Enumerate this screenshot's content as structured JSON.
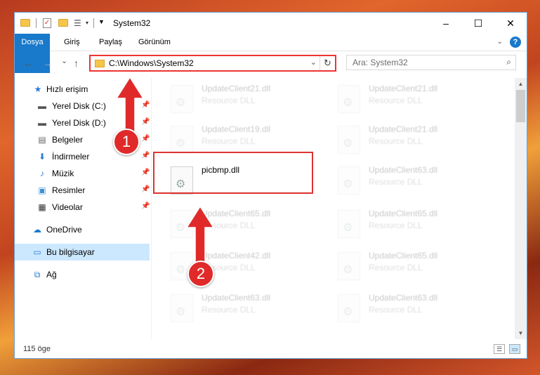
{
  "titlebar": {
    "title": "System32",
    "minimize": "–",
    "maximize": "☐",
    "close": "✕"
  },
  "ribbon": {
    "tabs": [
      "Dosya",
      "Giriş",
      "Paylaş",
      "Görünüm"
    ],
    "help": "?"
  },
  "nav": {
    "back": "←",
    "forward": "→",
    "recent": "⌄",
    "up": "↑",
    "address": "C:\\Windows\\System32",
    "refresh": "↻",
    "search_placeholder": "Ara: System32"
  },
  "sidebar": {
    "items": [
      {
        "label": "Hızlı erişim",
        "icon": "star-icon",
        "pinned": false
      },
      {
        "label": "Yerel Disk (C:)",
        "icon": "drive-icon",
        "pinned": true
      },
      {
        "label": "Yerel Disk (D:)",
        "icon": "drive-icon",
        "pinned": true
      },
      {
        "label": "Belgeler",
        "icon": "document-icon",
        "pinned": true
      },
      {
        "label": "İndirmeler",
        "icon": "download-icon",
        "pinned": true
      },
      {
        "label": "Müzik",
        "icon": "music-icon",
        "pinned": true
      },
      {
        "label": "Resimler",
        "icon": "pictures-icon",
        "pinned": true
      },
      {
        "label": "Videolar",
        "icon": "video-icon",
        "pinned": true
      },
      {
        "label": "OneDrive",
        "icon": "cloud-icon",
        "pinned": false
      },
      {
        "label": "Bu bilgisayar",
        "icon": "computer-icon",
        "pinned": false
      },
      {
        "label": "Ağ",
        "icon": "network-icon",
        "pinned": false
      }
    ]
  },
  "files": [
    {
      "name": "UpdateClient21.dll",
      "type": "Resource DLL"
    },
    {
      "name": "UpdateClient21.dll",
      "type": "Resource DLL"
    },
    {
      "name": "UpdateClient19.dll",
      "type": "Resource DLL"
    },
    {
      "name": "UpdateClient21.dll",
      "type": "Resource DLL"
    },
    {
      "name": "picbmp.dll",
      "type": ""
    },
    {
      "name": "UpdateClient63.dll",
      "type": "Resource DLL"
    },
    {
      "name": "UpdateClient65.dll",
      "type": "Resource DLL"
    },
    {
      "name": "UpdateClient65.dll",
      "type": "Resource DLL"
    },
    {
      "name": "UpdateClient42.dll",
      "type": "Resource DLL"
    },
    {
      "name": "UpdateClient65.dll",
      "type": "Resource DLL"
    },
    {
      "name": "UpdateClient63.dll",
      "type": "Resource DLL"
    },
    {
      "name": "UpdateClient63.dll",
      "type": "Resource DLL"
    }
  ],
  "status": {
    "count": "115 öge"
  },
  "annotations": {
    "step1": "1",
    "step2": "2",
    "color": "#e02a2a"
  }
}
